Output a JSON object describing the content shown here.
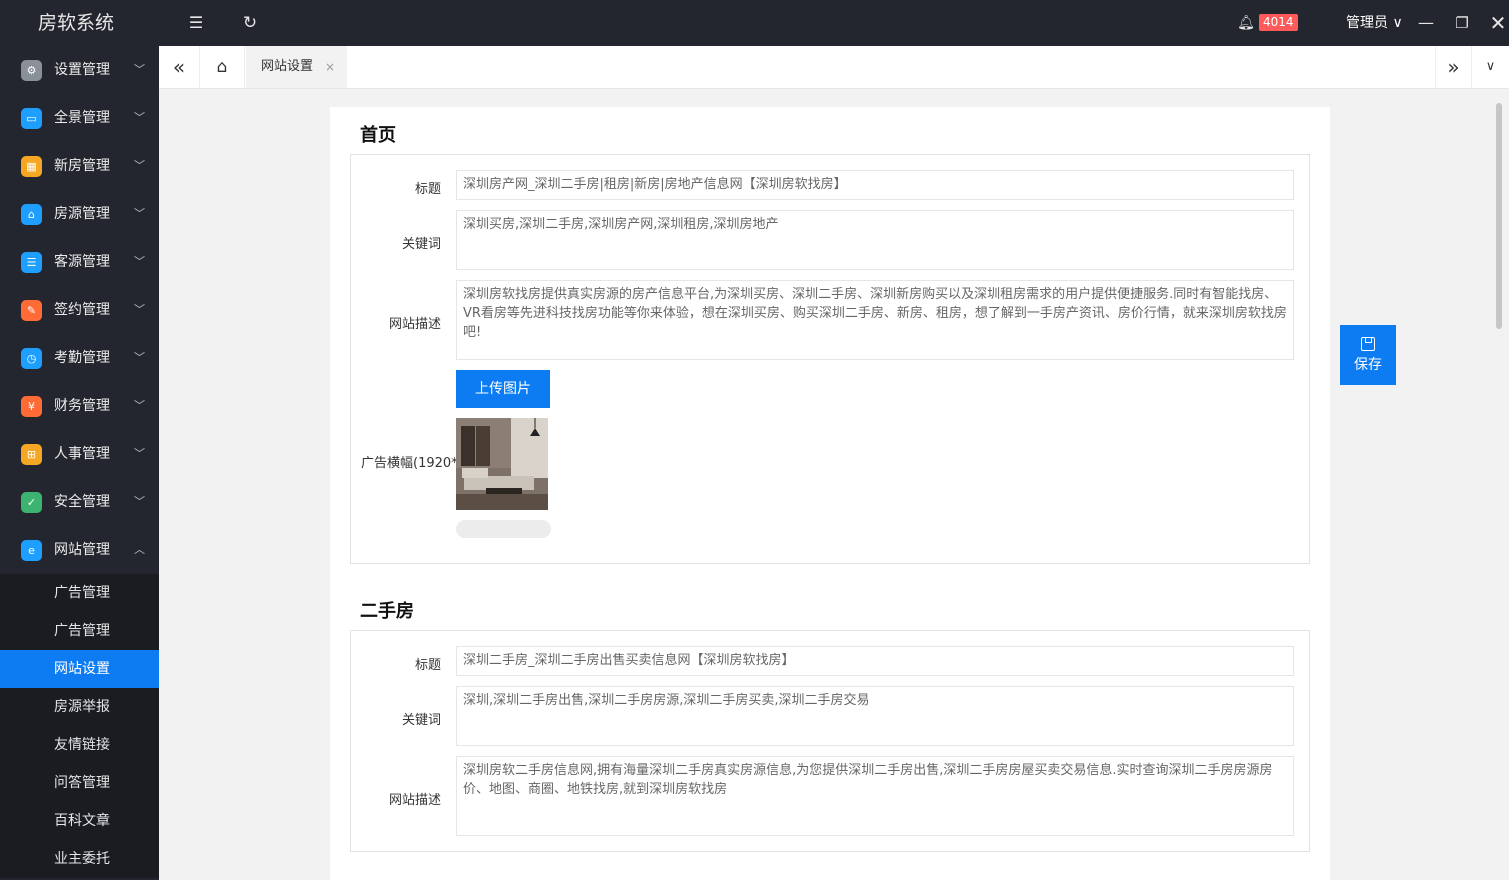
{
  "app": {
    "title": "房软系统"
  },
  "topbar": {
    "notice_count": "4014",
    "user_label": "管理员 ∨"
  },
  "sidebar": {
    "items": [
      {
        "label": "设置管理",
        "icon": "gear-icon",
        "color": "#8a9099"
      },
      {
        "label": "全景管理",
        "icon": "panorama-icon",
        "color": "#1e9fff"
      },
      {
        "label": "新房管理",
        "icon": "building-icon",
        "color": "#f5a623"
      },
      {
        "label": "房源管理",
        "icon": "house-icon",
        "color": "#1e9fff"
      },
      {
        "label": "客源管理",
        "icon": "customer-icon",
        "color": "#1e9fff"
      },
      {
        "label": "签约管理",
        "icon": "contract-icon",
        "color": "#ff6b35"
      },
      {
        "label": "考勤管理",
        "icon": "clock-icon",
        "color": "#1e9fff"
      },
      {
        "label": "财务管理",
        "icon": "finance-icon",
        "color": "#ff6b35"
      },
      {
        "label": "人事管理",
        "icon": "org-icon",
        "color": "#f5a623"
      },
      {
        "label": "安全管理",
        "icon": "shield-icon",
        "color": "#3cb371"
      },
      {
        "label": "网站管理",
        "icon": "browser-icon",
        "color": "#1e9fff"
      }
    ],
    "sub_items": [
      "广告管理",
      "广告管理",
      "网站设置",
      "房源举报",
      "友情链接",
      "问答管理",
      "百科文章",
      "业主委托"
    ],
    "active_sub_index": 2
  },
  "tabs": {
    "active_label": "网站设置",
    "close_glyph": "×"
  },
  "home_section": {
    "title": "首页",
    "title_label": "标题",
    "title_value": "深圳房产网_深圳二手房|租房|新房|房地产信息网【深圳房软找房】",
    "keywords_label": "关键词",
    "keywords_value": "深圳买房,深圳二手房,深圳房产网,深圳租房,深圳房地产",
    "desc_label": "网站描述",
    "desc_value": "深圳房软找房提供真实房源的房产信息平台,为深圳买房、深圳二手房、深圳新房购买以及深圳租房需求的用户提供便捷服务.同时有智能找房、VR看房等先进科技找房功能等你来体验，想在深圳买房、购买深圳二手房、新房、租房，想了解到一手房产资讯、房价行情，就来深圳房软找房吧!",
    "upload_label": "上传图片",
    "banner_label": "广告横幅(1920*"
  },
  "second_section": {
    "title": "二手房",
    "title_label": "标题",
    "title_value": "深圳二手房_深圳二手房出售买卖信息网【深圳房软找房】",
    "keywords_label": "关键词",
    "keywords_value": "深圳,深圳二手房出售,深圳二手房房源,深圳二手房买卖,深圳二手房交易",
    "desc_label": "网站描述",
    "desc_value": "深圳房软二手房信息网,拥有海量深圳二手房真实房源信息,为您提供深圳二手房出售,深圳二手房房屋买卖交易信息.实时查询深圳二手房房源房价、地图、商圈、地铁找房,就到深圳房软找房"
  },
  "save": {
    "label": "保存"
  },
  "colors": {
    "accent": "#0d7cf2",
    "sidebar_bg": "#23262e",
    "badge": "#ff5a5a"
  }
}
